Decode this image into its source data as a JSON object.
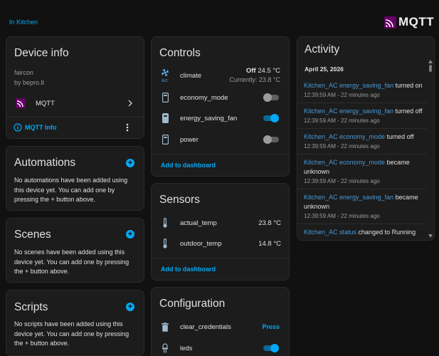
{
  "breadcrumb": "In Kitchen",
  "brand": "MQTT",
  "device_info": {
    "title": "Device info",
    "model": "faircon",
    "manufacturer": "by bepro.lt",
    "integration": "MQTT",
    "mqtt_info": "MQTT Info"
  },
  "automations": {
    "title": "Automations",
    "empty": "No automations have been added using this device yet. You can add one by pressing the + button above."
  },
  "scenes": {
    "title": "Scenes",
    "empty": "No scenes have been added using this device yet. You can add one by pressing the + button above."
  },
  "scripts": {
    "title": "Scripts",
    "empty": "No scripts have been added using this device yet. You can add one by pressing the + button above."
  },
  "controls": {
    "title": "Controls",
    "climate": {
      "name": "climate",
      "state": "Off",
      "target": "24.5 °C",
      "current": "Currently: 23.8 °C"
    },
    "switches": [
      {
        "name": "economy_mode",
        "on": false
      },
      {
        "name": "energy_saving_fan",
        "on": true
      },
      {
        "name": "power",
        "on": false
      }
    ],
    "add": "Add to dashboard"
  },
  "sensors": {
    "title": "Sensors",
    "items": [
      {
        "name": "actual_temp",
        "value": "23.8 °C"
      },
      {
        "name": "outdoor_temp",
        "value": "14.8 °C"
      }
    ],
    "add": "Add to dashboard"
  },
  "configuration": {
    "title": "Configuration",
    "items": [
      {
        "name": "clear_credentials",
        "action": "Press"
      },
      {
        "name": "leds",
        "on": true
      }
    ]
  },
  "activity": {
    "title": "Activity",
    "date": "April 25, 2026",
    "items": [
      {
        "entity": "Kitchen_AC energy_saving_fan",
        "action": " turned on",
        "time": "12:39:59 AM - 22 minutes ago"
      },
      {
        "entity": "Kitchen_AC energy_saving_fan",
        "action": " turned off",
        "time": "12:39:59 AM - 22 minutes ago"
      },
      {
        "entity": "Kitchen_AC economy_mode",
        "action": " turned off",
        "time": "12:39:59 AM - 22 minutes ago"
      },
      {
        "entity": "Kitchen_AC economy_mode",
        "action": " became unknown",
        "time": "12:39:59 AM - 22 minutes ago"
      },
      {
        "entity": "Kitchen_AC energy_saving_fan",
        "action": " became unknown",
        "time": "12:39:59 AM - 22 minutes ago"
      },
      {
        "entity": "Kitchen_AC status",
        "action": " changed to Running",
        "time": ""
      }
    ]
  },
  "colors": {
    "accent": "#03a9f4",
    "background": "#111111",
    "card": "#1c1c1c",
    "mqtt_purple": "#660066"
  }
}
